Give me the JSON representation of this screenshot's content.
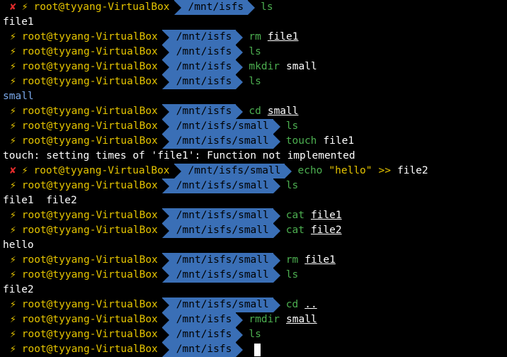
{
  "terminal": {
    "colors": {
      "background": "#000000",
      "context_fg": "#e5c400",
      "error_x": "#e32b2b",
      "dir_bg": "#3a6fb6",
      "command_green": "#4caf50",
      "dir_listing": "#7aa8ea"
    },
    "prompt": {
      "user_host": "root@tyyang-VirtualBox",
      "bolt": "⚡",
      "error_mark": "✘"
    },
    "lines": [
      {
        "kind": "prompt",
        "status": "error",
        "dir": "/mnt/isfs",
        "cmd": "ls",
        "args": []
      },
      {
        "kind": "output",
        "text": "file1"
      },
      {
        "kind": "prompt",
        "status": "ok",
        "dir": "/mnt/isfs",
        "cmd": "rm",
        "args": [
          "file1"
        ]
      },
      {
        "kind": "prompt",
        "status": "ok",
        "dir": "/mnt/isfs",
        "cmd": "ls",
        "args": []
      },
      {
        "kind": "prompt",
        "status": "ok",
        "dir": "/mnt/isfs",
        "cmd": "mkdir",
        "args_plain": [
          "small"
        ]
      },
      {
        "kind": "prompt",
        "status": "ok",
        "dir": "/mnt/isfs",
        "cmd": "ls",
        "args": []
      },
      {
        "kind": "output",
        "text": "small",
        "style": "dirname"
      },
      {
        "kind": "prompt",
        "status": "ok",
        "dir": "/mnt/isfs",
        "cmd": "cd",
        "args": [
          "small"
        ]
      },
      {
        "kind": "prompt",
        "status": "ok",
        "dir": "/mnt/isfs/small",
        "cmd": "ls",
        "args": []
      },
      {
        "kind": "prompt",
        "status": "ok",
        "dir": "/mnt/isfs/small",
        "cmd": "touch",
        "args_plain": [
          "file1"
        ]
      },
      {
        "kind": "output",
        "text": "touch: setting times of 'file1': Function not implemented"
      },
      {
        "kind": "prompt",
        "status": "error",
        "dir": "/mnt/isfs/small",
        "cmd": "echo",
        "string": "\"hello\"",
        "op": ">>",
        "args_plain": [
          "file2"
        ]
      },
      {
        "kind": "prompt",
        "status": "ok",
        "dir": "/mnt/isfs/small",
        "cmd": "ls",
        "args": []
      },
      {
        "kind": "output",
        "text": "file1  file2"
      },
      {
        "kind": "prompt",
        "status": "ok",
        "dir": "/mnt/isfs/small",
        "cmd": "cat",
        "args": [
          "file1"
        ]
      },
      {
        "kind": "prompt",
        "status": "ok",
        "dir": "/mnt/isfs/small",
        "cmd": "cat",
        "args": [
          "file2"
        ]
      },
      {
        "kind": "output",
        "text": "hello"
      },
      {
        "kind": "prompt",
        "status": "ok",
        "dir": "/mnt/isfs/small",
        "cmd": "rm",
        "args": [
          "file1"
        ]
      },
      {
        "kind": "prompt",
        "status": "ok",
        "dir": "/mnt/isfs/small",
        "cmd": "ls",
        "args": []
      },
      {
        "kind": "output",
        "text": "file2"
      },
      {
        "kind": "prompt",
        "status": "ok",
        "dir": "/mnt/isfs/small",
        "cmd": "cd",
        "args": [
          ".."
        ]
      },
      {
        "kind": "prompt",
        "status": "ok",
        "dir": "/mnt/isfs",
        "cmd": "rmdir",
        "args": [
          "small"
        ]
      },
      {
        "kind": "prompt",
        "status": "ok",
        "dir": "/mnt/isfs",
        "cmd": "ls",
        "args": []
      },
      {
        "kind": "prompt",
        "status": "ok",
        "dir": "/mnt/isfs",
        "cmd": "",
        "args": [],
        "cursor": true
      }
    ]
  }
}
